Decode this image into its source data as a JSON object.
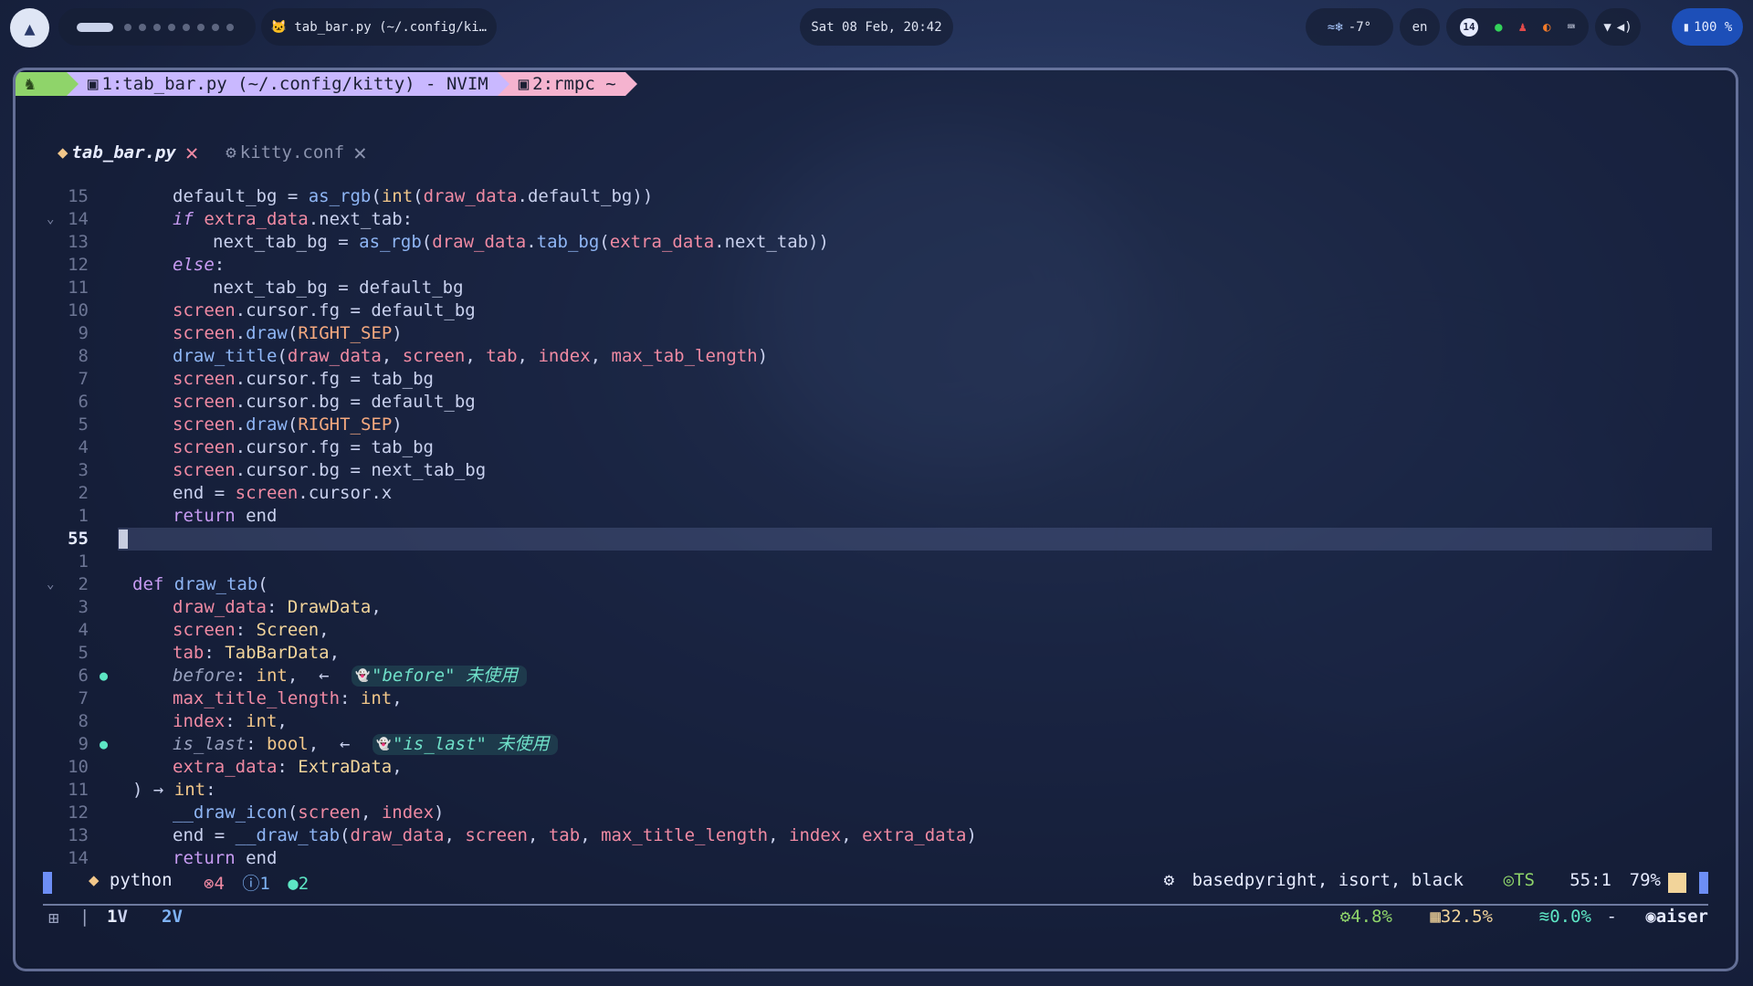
{
  "topbar": {
    "active_window": "tab_bar.py (~/.config/ki…",
    "clock": "Sat 08 Feb, 20:42",
    "weather": "-7°",
    "language": "en",
    "notification_count": "14",
    "battery": "100 %"
  },
  "kitty_tabs": [
    {
      "label": "1:tab_bar.py (~/.config/kitty) - NVIM"
    },
    {
      "label": "2:rmpc ~"
    }
  ],
  "buffers": [
    {
      "name": "tab_bar.py",
      "active": true
    },
    {
      "name": "kitty.conf",
      "active": false
    }
  ],
  "lines": [
    {
      "num": "15",
      "indent": 1,
      "text": "default_bg = as_rgb(int(draw_data.default_bg))"
    },
    {
      "num": "14",
      "indent": 1,
      "text": "if extra_data.next_tab:",
      "fold": true
    },
    {
      "num": "13",
      "indent": 2,
      "text": "next_tab_bg = as_rgb(draw_data.tab_bg(extra_data.next_tab))"
    },
    {
      "num": "12",
      "indent": 1,
      "text": "else:"
    },
    {
      "num": "11",
      "indent": 2,
      "text": "next_tab_bg = default_bg"
    },
    {
      "num": "10",
      "indent": 1,
      "text": "screen.cursor.fg = default_bg"
    },
    {
      "num": "9",
      "indent": 1,
      "text": "screen.draw(RIGHT_SEP)"
    },
    {
      "num": "8",
      "indent": 1,
      "text": "draw_title(draw_data, screen, tab, index, max_tab_length)"
    },
    {
      "num": "7",
      "indent": 1,
      "text": "screen.cursor.fg = tab_bg"
    },
    {
      "num": "6",
      "indent": 1,
      "text": "screen.cursor.bg = default_bg"
    },
    {
      "num": "5",
      "indent": 1,
      "text": "screen.draw(RIGHT_SEP)"
    },
    {
      "num": "4",
      "indent": 1,
      "text": "screen.cursor.fg = tab_bg"
    },
    {
      "num": "3",
      "indent": 1,
      "text": "screen.cursor.bg = next_tab_bg"
    },
    {
      "num": "2",
      "indent": 1,
      "text": "end = screen.cursor.x"
    },
    {
      "num": "1",
      "indent": 1,
      "text": "return end"
    },
    {
      "num": "55",
      "indent": 0,
      "text": "",
      "current": true
    },
    {
      "num": "1",
      "indent": 0,
      "text": ""
    },
    {
      "num": "2",
      "indent": 0,
      "text": "def draw_tab(",
      "fold": true
    },
    {
      "num": "3",
      "indent": 1,
      "text": "draw_data: DrawData,"
    },
    {
      "num": "4",
      "indent": 1,
      "text": "screen: Screen,"
    },
    {
      "num": "5",
      "indent": 1,
      "text": "tab: TabBarData,"
    },
    {
      "num": "6",
      "indent": 1,
      "text": "before: int,  ←",
      "sign": true,
      "hint": "\"before\" 未使用"
    },
    {
      "num": "7",
      "indent": 1,
      "text": "max_title_length: int,"
    },
    {
      "num": "8",
      "indent": 1,
      "text": "index: int,"
    },
    {
      "num": "9",
      "indent": 1,
      "text": "is_last: bool,  ←",
      "sign": true,
      "hint": "\"is_last\" 未使用"
    },
    {
      "num": "10",
      "indent": 1,
      "text": "extra_data: ExtraData,"
    },
    {
      "num": "11",
      "indent": 0,
      "text": ") → int:"
    },
    {
      "num": "12",
      "indent": 1,
      "text": "__draw_icon(screen, index)"
    },
    {
      "num": "13",
      "indent": 1,
      "text": "end = __draw_tab(draw_data, screen, tab, max_title_length, index, extra_data)"
    },
    {
      "num": "14",
      "indent": 1,
      "text": "return end"
    }
  ],
  "statusline": {
    "filetype": "python",
    "errors": "4",
    "info": "1",
    "hints": "2",
    "lsp": "basedpyright, isort, black",
    "ts": "TS",
    "position": "55:1",
    "percent": "79%"
  },
  "bottombar": {
    "views": [
      "1",
      "2"
    ],
    "cpu": "4.8%",
    "mem": "32.5%",
    "disk": "0.0%",
    "dash": "-",
    "user": "aiser"
  },
  "colors": {
    "kitty_tab1": "#c9b8ff",
    "kitty_tab2": "#f5b3cf",
    "kitty_home": "#8fd46a",
    "close_active": "#f08aa3"
  }
}
